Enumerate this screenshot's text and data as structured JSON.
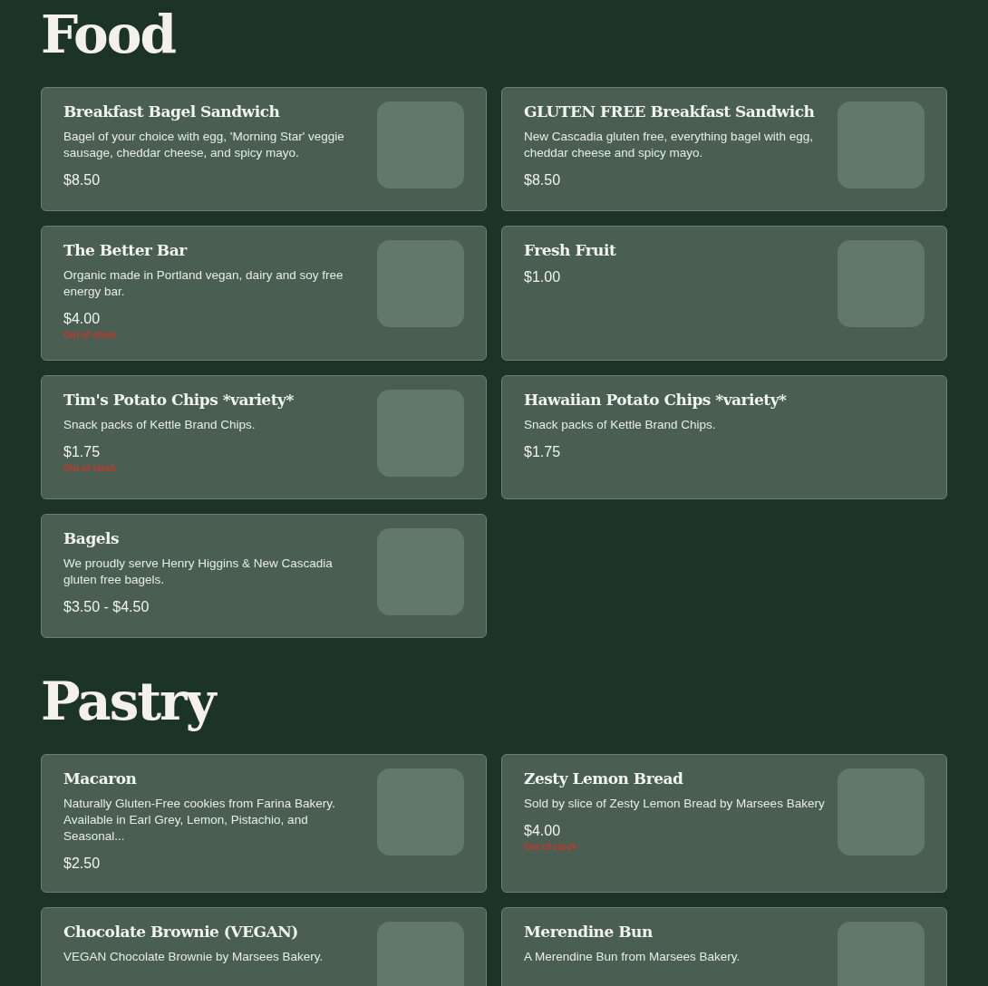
{
  "sections": [
    {
      "title": "Food",
      "items": [
        {
          "name": "Breakfast Bagel Sandwich",
          "description": "Bagel of your choice with egg, 'Morning Star' veggie sausage, cheddar cheese, and spicy mayo.",
          "price": "$8.50",
          "image": true
        },
        {
          "name": "GLUTEN FREE Breakfast Sandwich",
          "description": "New Cascadia gluten free, everything bagel with egg, cheddar cheese and spicy mayo.",
          "price": "$8.50",
          "image": true
        },
        {
          "name": "The Better Bar",
          "description": "Organic made in Portland vegan, dairy and soy free energy bar.",
          "price": "$4.00",
          "stock_label": "Out of stock",
          "image": true
        },
        {
          "name": "Fresh Fruit",
          "price": "$1.00",
          "image": true
        },
        {
          "name": "Tim's Potato Chips *variety*",
          "description": "Snack packs of Kettle Brand Chips.",
          "price": "$1.75",
          "stock_label": "Out of stock",
          "image": true
        },
        {
          "name": "Hawaiian Potato Chips *variety*",
          "description": "Snack packs of Kettle Brand Chips.",
          "price": "$1.75",
          "image": false
        },
        {
          "name": "Bagels",
          "description": "We proudly serve Henry Higgins & New Cascadia gluten free bagels.",
          "price": "$3.50 - $4.50",
          "image": true
        }
      ]
    },
    {
      "title": "Pastry",
      "items": [
        {
          "name": "Macaron",
          "description": "Naturally Gluten-Free cookies from Farina Bakery. Available in Earl Grey, Lemon, Pistachio, and Seasonal...",
          "price": "$2.50",
          "image": true
        },
        {
          "name": "Zesty Lemon Bread",
          "description": "Sold by slice of Zesty Lemon Bread by Marsees Bakery",
          "price": "$4.00",
          "stock_label": "Out of stock",
          "image": true
        },
        {
          "name": "Chocolate Brownie (VEGAN)",
          "description": "VEGAN Chocolate Brownie by Marsees Bakery.",
          "image": true
        },
        {
          "name": "Merendine Bun",
          "description": "A Merendine Bun from Marsees Bakery.",
          "image": true
        }
      ]
    }
  ]
}
